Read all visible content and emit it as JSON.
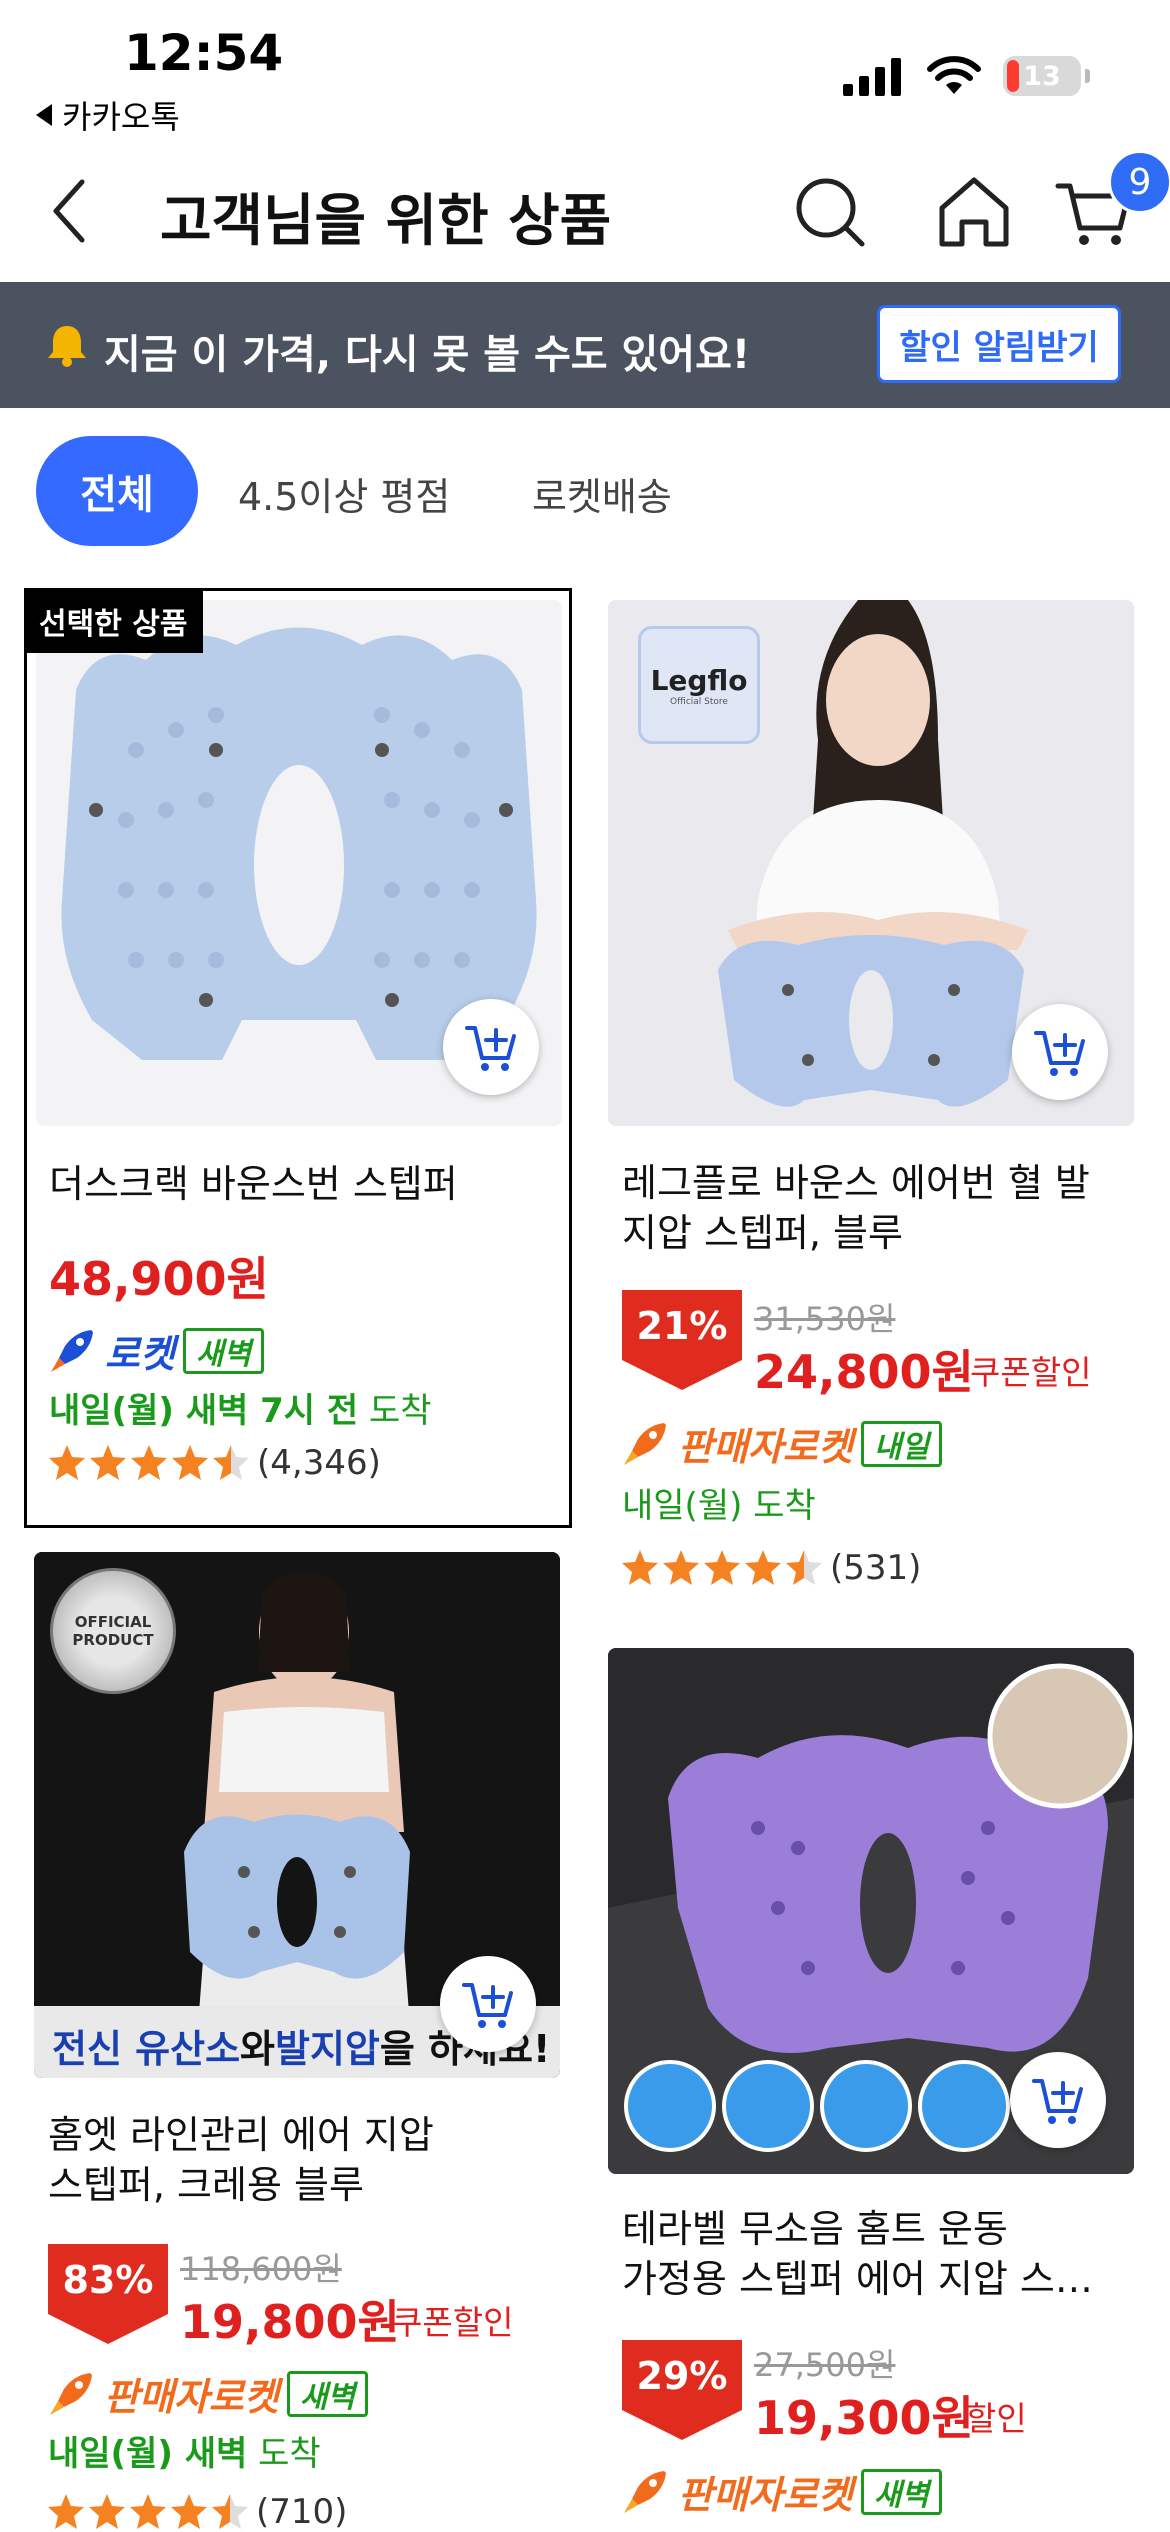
{
  "status": {
    "time": "12:54",
    "back_app": "카카오톡",
    "battery": "13"
  },
  "header": {
    "title": "고객님을 위한 상품",
    "cart_count": "9"
  },
  "banner": {
    "text": "지금 이 가격, 다시 못 볼 수도 있어요!",
    "button": "할인 알림받기"
  },
  "filters": {
    "all": "전체",
    "rating": "4.5이상 평점",
    "rocket": "로켓배송"
  },
  "colors": {
    "accent": "#346aff",
    "price": "#e01f1f",
    "rocket_blue": "#1a4fd6",
    "seller_rocket": "#f26b1d",
    "green": "#1a9a1a",
    "banner_bg": "#4a535f"
  },
  "products": [
    {
      "selected_label": "선택한 상품",
      "name": "더스크랙 바운스번 스텝퍼",
      "price": "48,900원",
      "rocket": "로켓",
      "tag": "새벽",
      "delivery_prefix": "내일(월) 새벽 7시 전",
      "delivery_suffix": "도착",
      "rating": 4.5,
      "reviews": "(4,346)"
    },
    {
      "brand_logo": "Legflo",
      "brand_sub": "Official Store",
      "name_line1": "레그플로 바운스 에어번 혈 발",
      "name_line2": "지압 스텝퍼, 블루",
      "discount": "21%",
      "original_price": "31,530원",
      "price": "24,800원",
      "price_note": "쿠폰할인",
      "rocket": "판매자로켓",
      "tag": "내일",
      "delivery_prefix": "내일(월)",
      "delivery_suffix": "도착",
      "rating": 4.5,
      "reviews": "(531)"
    },
    {
      "badge_line1": "OFFICIAL",
      "badge_line2": "PRODUCT",
      "img_caption_1": "전신 유산소",
      "img_caption_2": "와",
      "img_caption_3": "발지압",
      "img_caption_4": "을 하세요!",
      "name_line1": "홈엣 라인관리 에어 지압",
      "name_line2": "스텝퍼, 크레용 블루",
      "discount": "83%",
      "original_price": "118,600원",
      "price": "19,800원",
      "price_note": "쿠폰할인",
      "rocket": "판매자로켓",
      "tag": "새벽",
      "delivery_prefix": "내일(월) 새벽",
      "delivery_suffix": "도착",
      "rating": 4.5,
      "reviews": "(710)"
    },
    {
      "name_line1": "테라벨 무소음 홈트 운동",
      "name_line2": "가정용 스텝퍼 에어 지압 스…",
      "discount": "29%",
      "original_price": "27,500원",
      "price": "19,300원",
      "price_note": "할인",
      "rocket": "판매자로켓",
      "tag": "새벽"
    }
  ]
}
